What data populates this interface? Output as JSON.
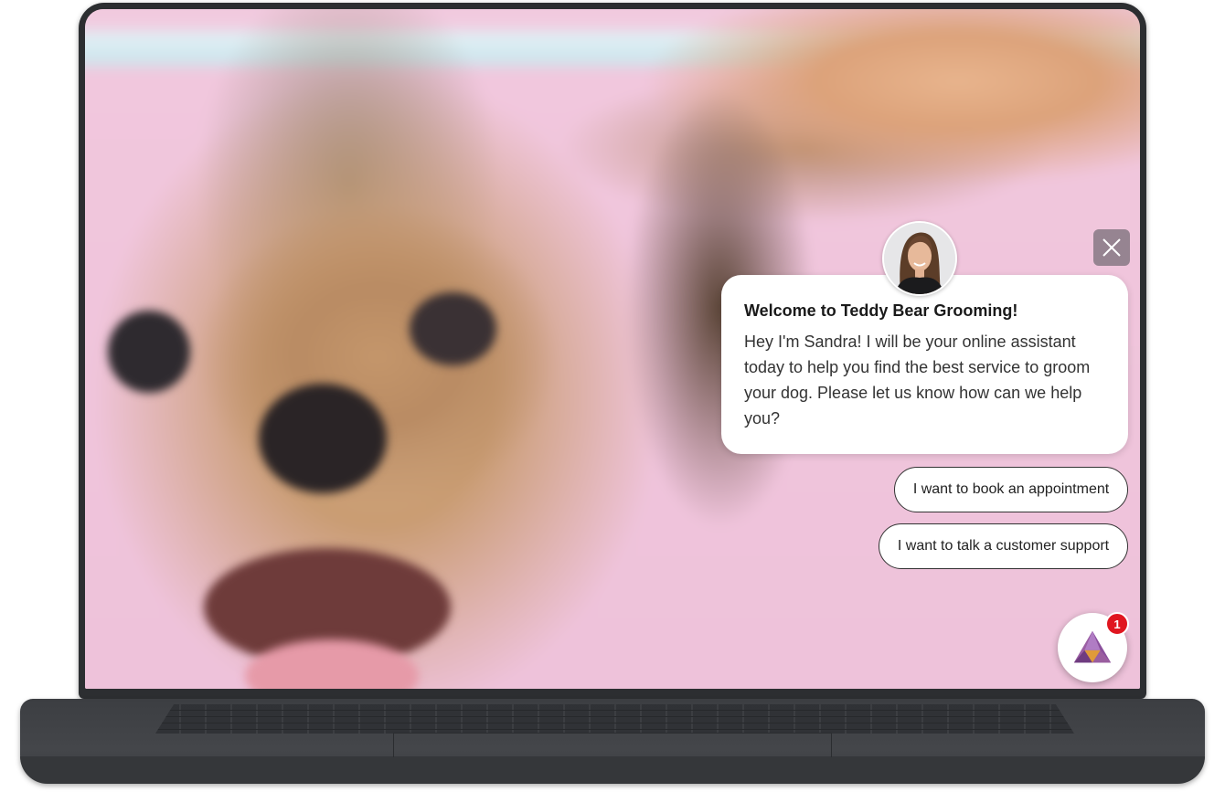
{
  "chat": {
    "title": "Welcome to Teddy Bear Grooming!",
    "message": "Hey I'm Sandra! I will be your online assistant today to help you find the best service to groom your dog. Please let us know how can we help you?",
    "quick_replies": [
      "I want to book an appointment",
      "I want to talk a customer support"
    ],
    "close_icon": "close-icon",
    "avatar_icon": "assistant-avatar"
  },
  "launcher": {
    "icon": "gem-icon",
    "badge_count": "1"
  },
  "colors": {
    "badge": "#e0161f",
    "background_pink": "#f0c5dc",
    "laptop": "#2c2e31"
  }
}
